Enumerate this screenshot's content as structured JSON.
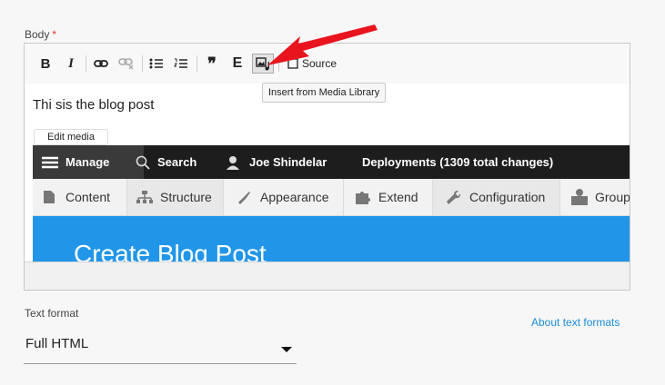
{
  "body_field": {
    "label": "Body",
    "required_mark": "*"
  },
  "toolbar": {
    "bold": "B",
    "italic": "I",
    "blockquote": "❞",
    "embed": "E",
    "source_label": "Source"
  },
  "tooltip": "Insert from Media Library",
  "editor": {
    "paragraph": "Thi sis the blog post",
    "edit_media": "Edit media"
  },
  "embedded_screenshot": {
    "admin_bar": {
      "manage": "Manage",
      "search": "Search",
      "user": "Joe Shindelar",
      "deployments": "Deployments (1309 total changes)"
    },
    "tray": [
      "Content",
      "Structure",
      "Appearance",
      "Extend",
      "Configuration",
      "Group"
    ],
    "page_title": "Create Blog Post",
    "colors": {
      "admin_bar": "#1d1d1d",
      "blue": "#2196e8"
    }
  },
  "text_format": {
    "label": "Text format",
    "selected": "Full HTML",
    "about_link": "About text formats"
  },
  "annotation": {
    "arrow_color": "#e8141e"
  }
}
